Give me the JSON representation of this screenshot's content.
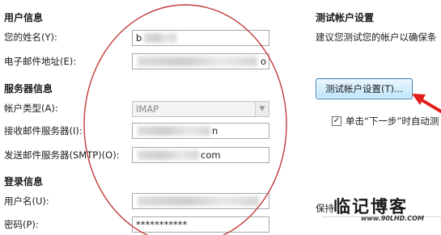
{
  "left": {
    "user_info": {
      "title": "用户信息",
      "name_label": "您的姓名(Y):",
      "name_value": "b",
      "email_label": "电子邮件地址(E):",
      "email_value": "o"
    },
    "server_info": {
      "title": "服务器信息",
      "account_type_label": "帐户类型(A):",
      "account_type_value": "IMAP",
      "incoming_label": "接收邮件服务器(I):",
      "incoming_value": "n",
      "outgoing_label": "发送邮件服务器(SMTP)(O):",
      "outgoing_value": "com"
    },
    "login_info": {
      "title": "登录信息",
      "username_label": "用户名(U):",
      "password_label": "密码(P):",
      "password_value": "***********"
    }
  },
  "right": {
    "title": "测试帐户设置",
    "description": "建议您测试您的帐户以确保条",
    "test_button_label": "测试帐户设置(T)...",
    "checkbox_checked": true,
    "checkbox_label": "单击“下一步”时自动测",
    "keep_label": "保持"
  },
  "watermark": {
    "main": "临记博客",
    "url": "www.90LHD.COM"
  },
  "annotation_colors": {
    "ellipse": "#c23a3a",
    "arrow": "#e0201b"
  }
}
